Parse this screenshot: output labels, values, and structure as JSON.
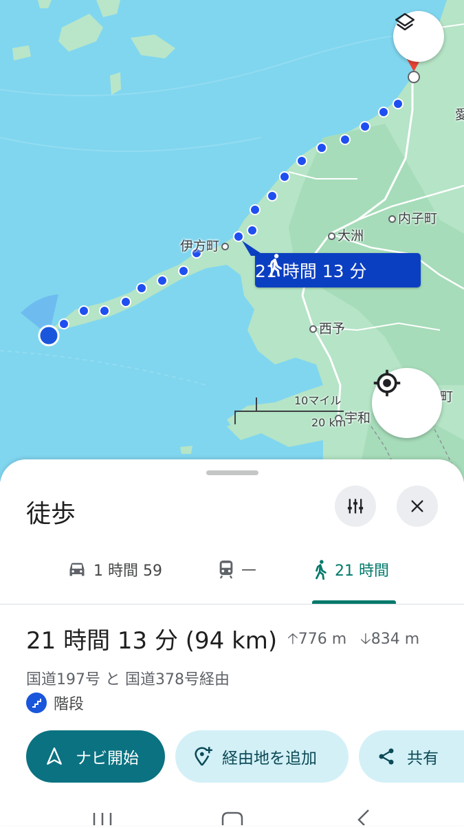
{
  "map": {
    "places": {
      "ikata": "伊方町",
      "ozu": "大洲",
      "uchiko": "内子町",
      "seiyo": "西予",
      "uwa": "宇和",
      "edge_ai": "愛",
      "edge_machi": "町"
    },
    "route_label": "21 時間 13 分",
    "scale": {
      "miles": "10マイル",
      "km": "20 km"
    },
    "layers_button_icon": "layers-icon",
    "my_location_icon": "crosshair-icon"
  },
  "sheet": {
    "title": "徒歩",
    "tabs": [
      {
        "icon": "car-icon",
        "label": "1 時間 59"
      },
      {
        "icon": "train-icon",
        "label": "—"
      },
      {
        "icon": "walk-icon",
        "label": "21 時間",
        "active": true
      }
    ],
    "summary": "21 時間 13 分 (94 km)",
    "ascent": "776 m",
    "descent": "834 m",
    "via": "国道197号 と 国道378号経由",
    "steps_label": "階段",
    "buttons": {
      "navigate": "ナビ開始",
      "add_stop": "経由地を追加",
      "share": "共有"
    }
  },
  "colors": {
    "water": "#7dd4ee",
    "land": "#b5e4c6",
    "route": "#1f4ff0",
    "accent": "#00796b",
    "label_bg": "#0b3fc2"
  }
}
